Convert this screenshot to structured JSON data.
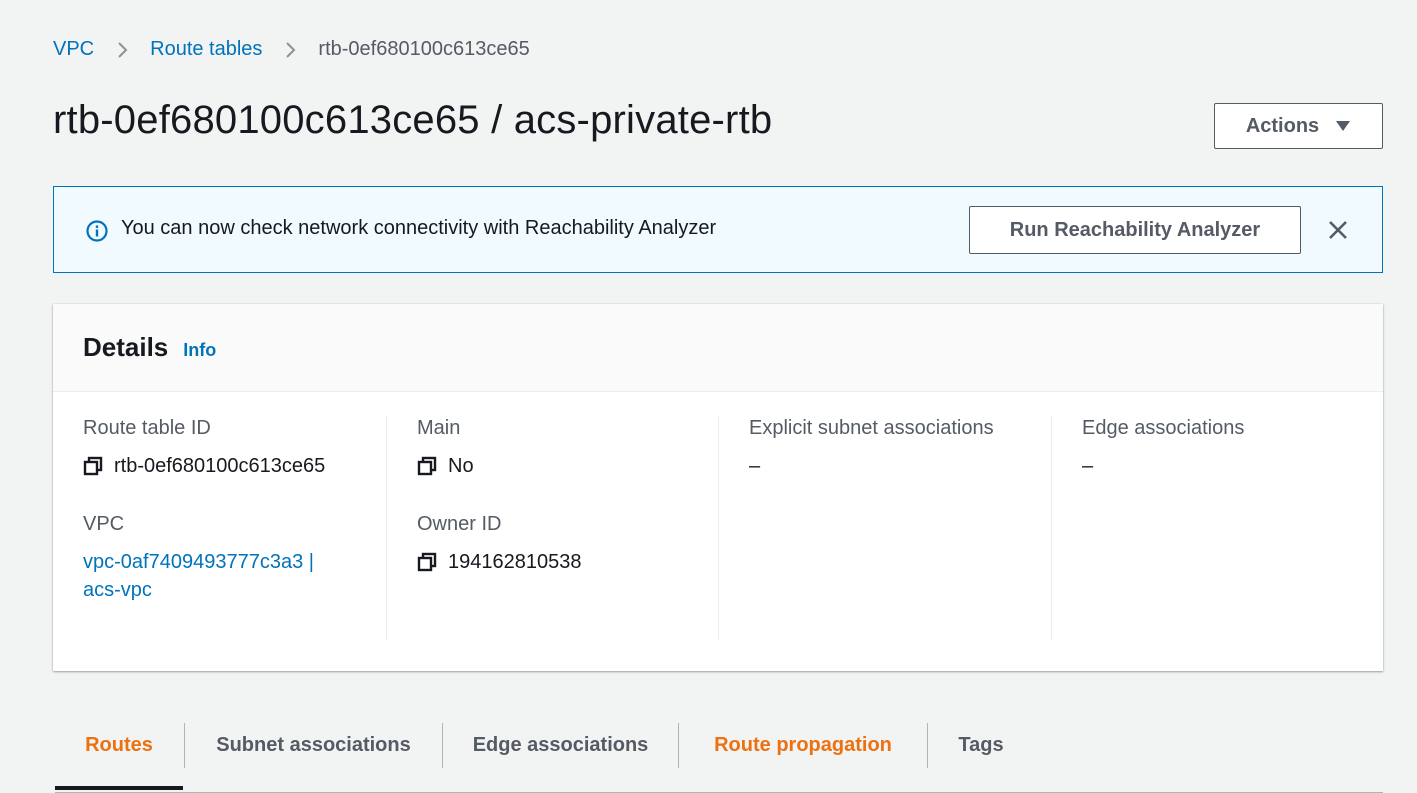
{
  "breadcrumb": {
    "items": [
      "VPC",
      "Route tables"
    ],
    "current": "rtb-0ef680100c613ce65"
  },
  "header": {
    "title": "rtb-0ef680100c613ce65 / acs-private-rtb",
    "actions_label": "Actions"
  },
  "alert": {
    "message": "You can now check network connectivity with Reachability Analyzer",
    "button_label": "Run Reachability Analyzer"
  },
  "details": {
    "title": "Details",
    "info_label": "Info",
    "route_table_id_label": "Route table ID",
    "route_table_id_value": "rtb-0ef680100c613ce65",
    "vpc_label": "VPC",
    "vpc_value": "vpc-0af7409493777c3a3 | acs-vpc",
    "main_label": "Main",
    "main_value": "No",
    "owner_id_label": "Owner ID",
    "owner_id_value": "194162810538",
    "explicit_subnet_label": "Explicit subnet associations",
    "explicit_subnet_value": "–",
    "edge_assoc_label": "Edge associations",
    "edge_assoc_value": "–"
  },
  "tabs": [
    "Routes",
    "Subnet associations",
    "Edge associations",
    "Route propagation",
    "Tags"
  ],
  "colors": {
    "link": "#0073bb",
    "accent_orange": "#ec7211",
    "alert_border": "#0073bb",
    "alert_bg": "#f1faff"
  },
  "icons": [
    "chevron-right-icon",
    "caret-down-icon",
    "info-icon",
    "close-icon",
    "copy-icon"
  ]
}
